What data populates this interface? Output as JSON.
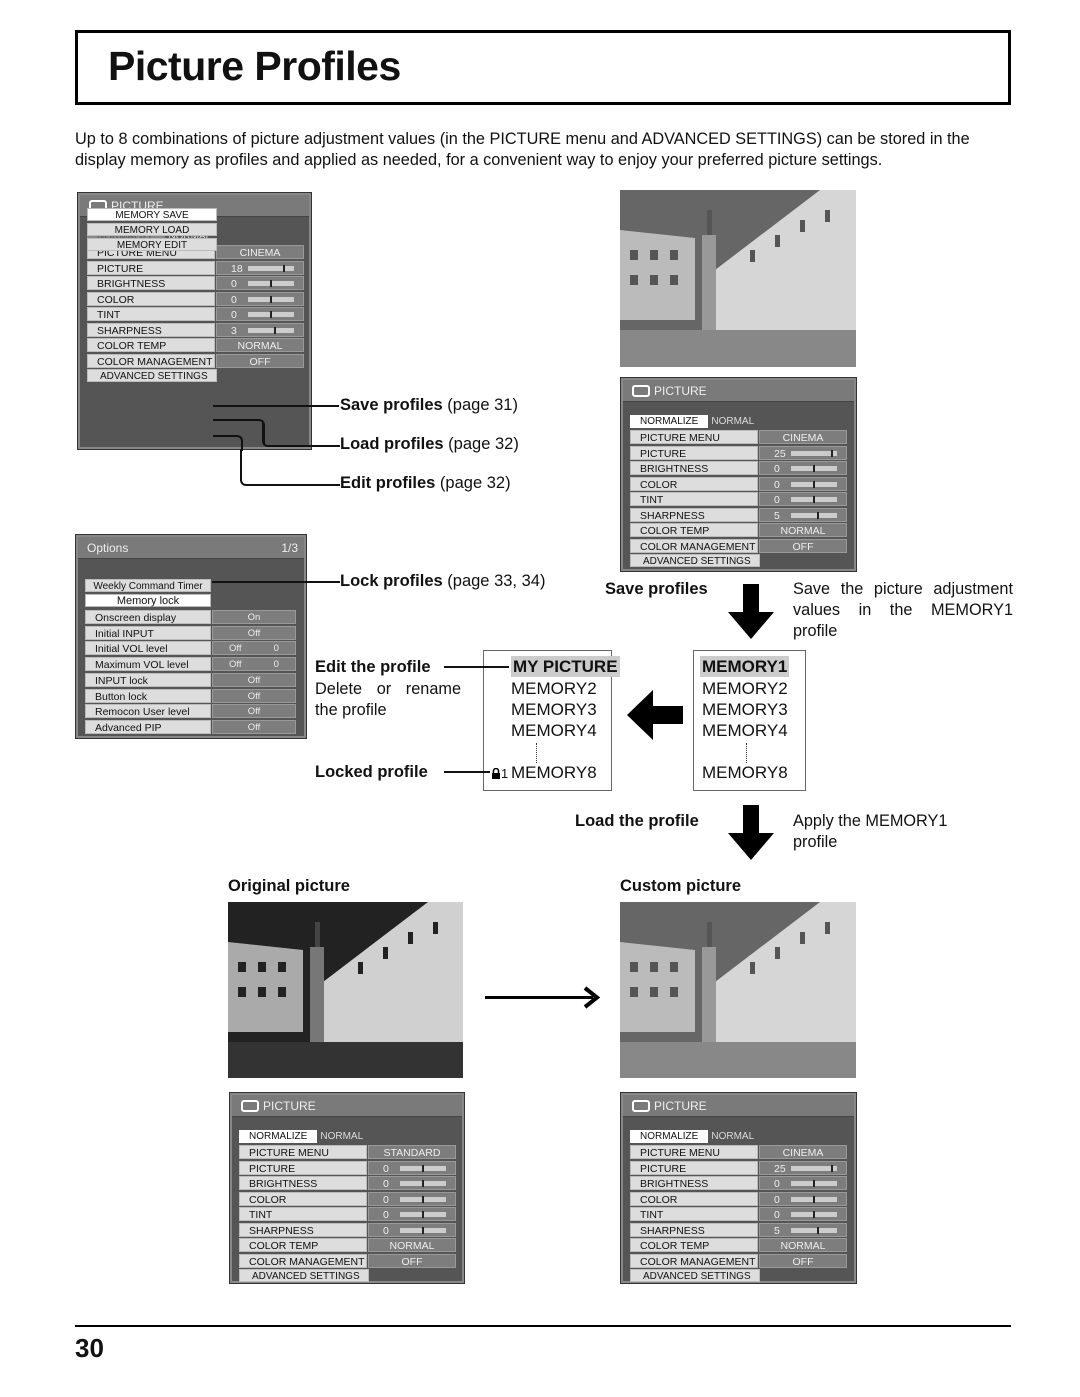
{
  "page": {
    "title": "Picture Profiles",
    "intro": "Up to 8 combinations of picture adjustment values (in the PICTURE menu and ADVANCED SETTINGS) can be stored in the display memory as profiles and applied as needed, for a convenient way to enjoy your preferred picture settings.",
    "page_number": "30"
  },
  "menu_top": {
    "title": "PICTURE",
    "normalize": "NORMALIZE",
    "normalize_value": "NORMAL",
    "rows": [
      {
        "label": "PICTURE MENU",
        "value": "CINEMA"
      },
      {
        "label": "PICTURE",
        "value": "18",
        "slider": 0.8
      },
      {
        "label": "BRIGHTNESS",
        "value": "0",
        "slider": 0.5
      },
      {
        "label": "COLOR",
        "value": "0",
        "slider": 0.5
      },
      {
        "label": "TINT",
        "value": "0",
        "slider": 0.5
      },
      {
        "label": "SHARPNESS",
        "value": "3",
        "slider": 0.6
      },
      {
        "label": "COLOR TEMP",
        "value": "NORMAL"
      },
      {
        "label": "COLOR MANAGEMENT",
        "value": "OFF"
      }
    ],
    "advanced": "ADVANCED SETTINGS",
    "memory_save": "MEMORY SAVE",
    "memory_load": "MEMORY LOAD",
    "memory_edit": "MEMORY EDIT"
  },
  "callouts": {
    "save": {
      "bold": "Save profiles",
      "ref": " (page 31)"
    },
    "load": {
      "bold": "Load profiles",
      "ref": " (page 32)"
    },
    "edit": {
      "bold": "Edit profiles",
      "ref": " (page 32)"
    },
    "lock": {
      "bold": "Lock profiles",
      "ref": " (page 33, 34)"
    }
  },
  "options_menu": {
    "title": "Options",
    "page": "1/3",
    "weekly": "Weekly Command Timer",
    "memory_lock": "Memory lock",
    "rows": [
      {
        "label": "Onscreen display",
        "value": "On"
      },
      {
        "label": "Initial INPUT",
        "value": "Off"
      },
      {
        "label": "Initial VOL level",
        "value": "Off",
        "value2": "0"
      },
      {
        "label": "Maximum VOL level",
        "value": "Off",
        "value2": "0"
      },
      {
        "label": "INPUT lock",
        "value": "Off"
      },
      {
        "label": "Button lock",
        "value": "Off"
      },
      {
        "label": "Remocon User level",
        "value": "Off"
      },
      {
        "label": "Advanced PIP",
        "value": "Off"
      }
    ]
  },
  "menu_right": {
    "title": "PICTURE",
    "normalize": "NORMALIZE",
    "normalize_value": "NORMAL",
    "rows": [
      {
        "label": "PICTURE MENU",
        "value": "CINEMA"
      },
      {
        "label": "PICTURE",
        "value": "25",
        "slider": 0.92
      },
      {
        "label": "BRIGHTNESS",
        "value": "0",
        "slider": 0.5
      },
      {
        "label": "COLOR",
        "value": "0",
        "slider": 0.5
      },
      {
        "label": "TINT",
        "value": "0",
        "slider": 0.5
      },
      {
        "label": "SHARPNESS",
        "value": "5",
        "slider": 0.6
      },
      {
        "label": "COLOR TEMP",
        "value": "NORMAL"
      },
      {
        "label": "COLOR MANAGEMENT",
        "value": "OFF"
      }
    ],
    "advanced": "ADVANCED SETTINGS"
  },
  "flow": {
    "save_label": "Save profiles",
    "save_desc": "Save the picture adjustment values in the MEMORY1 profile",
    "load_label": "Load the profile",
    "load_desc": "Apply the MEMORY1 profile",
    "edit_label": "Edit the profile",
    "edit_desc": "Delete or rename the profile",
    "locked_label": "Locked profile",
    "left_list": [
      "MY PICTURE",
      "MEMORY2",
      "MEMORY3",
      "MEMORY4",
      "MEMORY8"
    ],
    "lock_number": "1",
    "right_list": [
      "MEMORY1",
      "MEMORY2",
      "MEMORY3",
      "MEMORY4",
      "MEMORY8"
    ]
  },
  "bottom": {
    "original_label": "Original picture",
    "custom_label": "Custom picture",
    "menu_original": {
      "title": "PICTURE",
      "normalize": "NORMALIZE",
      "normalize_value": "NORMAL",
      "rows": [
        {
          "label": "PICTURE MENU",
          "value": "STANDARD"
        },
        {
          "label": "PICTURE",
          "value": "0",
          "slider": 0.5
        },
        {
          "label": "BRIGHTNESS",
          "value": "0",
          "slider": 0.5
        },
        {
          "label": "COLOR",
          "value": "0",
          "slider": 0.5
        },
        {
          "label": "TINT",
          "value": "0",
          "slider": 0.5
        },
        {
          "label": "SHARPNESS",
          "value": "0",
          "slider": 0.5
        },
        {
          "label": "COLOR TEMP",
          "value": "NORMAL"
        },
        {
          "label": "COLOR MANAGEMENT",
          "value": "OFF"
        }
      ],
      "advanced": "ADVANCED SETTINGS"
    },
    "menu_custom": {
      "title": "PICTURE",
      "normalize": "NORMALIZE",
      "normalize_value": "NORMAL",
      "rows": [
        {
          "label": "PICTURE MENU",
          "value": "CINEMA"
        },
        {
          "label": "PICTURE",
          "value": "25",
          "slider": 0.92
        },
        {
          "label": "BRIGHTNESS",
          "value": "0",
          "slider": 0.5
        },
        {
          "label": "COLOR",
          "value": "0",
          "slider": 0.5
        },
        {
          "label": "TINT",
          "value": "0",
          "slider": 0.5
        },
        {
          "label": "SHARPNESS",
          "value": "5",
          "slider": 0.6
        },
        {
          "label": "COLOR TEMP",
          "value": "NORMAL"
        },
        {
          "label": "COLOR MANAGEMENT",
          "value": "OFF"
        }
      ],
      "advanced": "ADVANCED SETTINGS"
    }
  }
}
